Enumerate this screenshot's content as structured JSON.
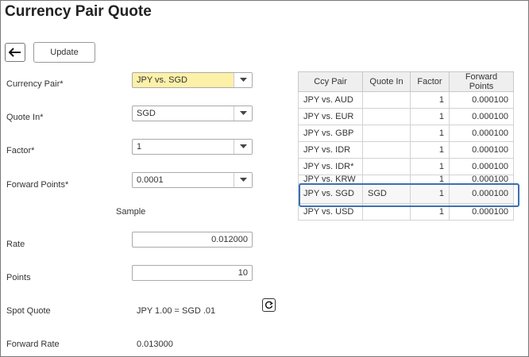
{
  "page": {
    "title": "Currency Pair Quote"
  },
  "toolbar": {
    "update_label": "Update"
  },
  "form": {
    "currency_pair": {
      "label": "Currency Pair*",
      "value": "JPY vs. SGD"
    },
    "quote_in": {
      "label": "Quote In*",
      "value": "SGD"
    },
    "factor": {
      "label": "Factor*",
      "value": "1"
    },
    "forward_points": {
      "label": "Forward Points*",
      "value": "0.0001"
    },
    "sample_label": "Sample",
    "rate": {
      "label": "Rate",
      "value": "0.012000"
    },
    "points": {
      "label": "Points",
      "value": "10"
    },
    "spot_quote": {
      "label": "Spot Quote",
      "value": "JPY 1.00 = SGD .01"
    },
    "forward_rate": {
      "label": "Forward Rate",
      "value": "0.013000"
    }
  },
  "grid": {
    "headers": [
      "Ccy Pair",
      "Quote In",
      "Factor",
      "Forward Points"
    ],
    "rows": [
      [
        "JPY vs. AUD",
        "",
        "1",
        "0.000100"
      ],
      [
        "JPY vs. EUR",
        "",
        "1",
        "0.000100"
      ],
      [
        "JPY vs. GBP",
        "",
        "1",
        "0.000100"
      ],
      [
        "JPY vs. IDR",
        "",
        "1",
        "0.000100"
      ],
      [
        "JPY vs. IDR*",
        "",
        "1",
        "0.000100"
      ],
      [
        "JPY vs. KRW",
        "",
        "1",
        "0.000100"
      ],
      [
        "JPY vs. SGD",
        "SGD",
        "1",
        "0.000100"
      ],
      [
        "JPY vs. USD",
        "",
        "1",
        "0.000100"
      ]
    ]
  },
  "colors": {
    "highlight": "#3d6fb0",
    "selected_field": "#fdf0a8"
  }
}
